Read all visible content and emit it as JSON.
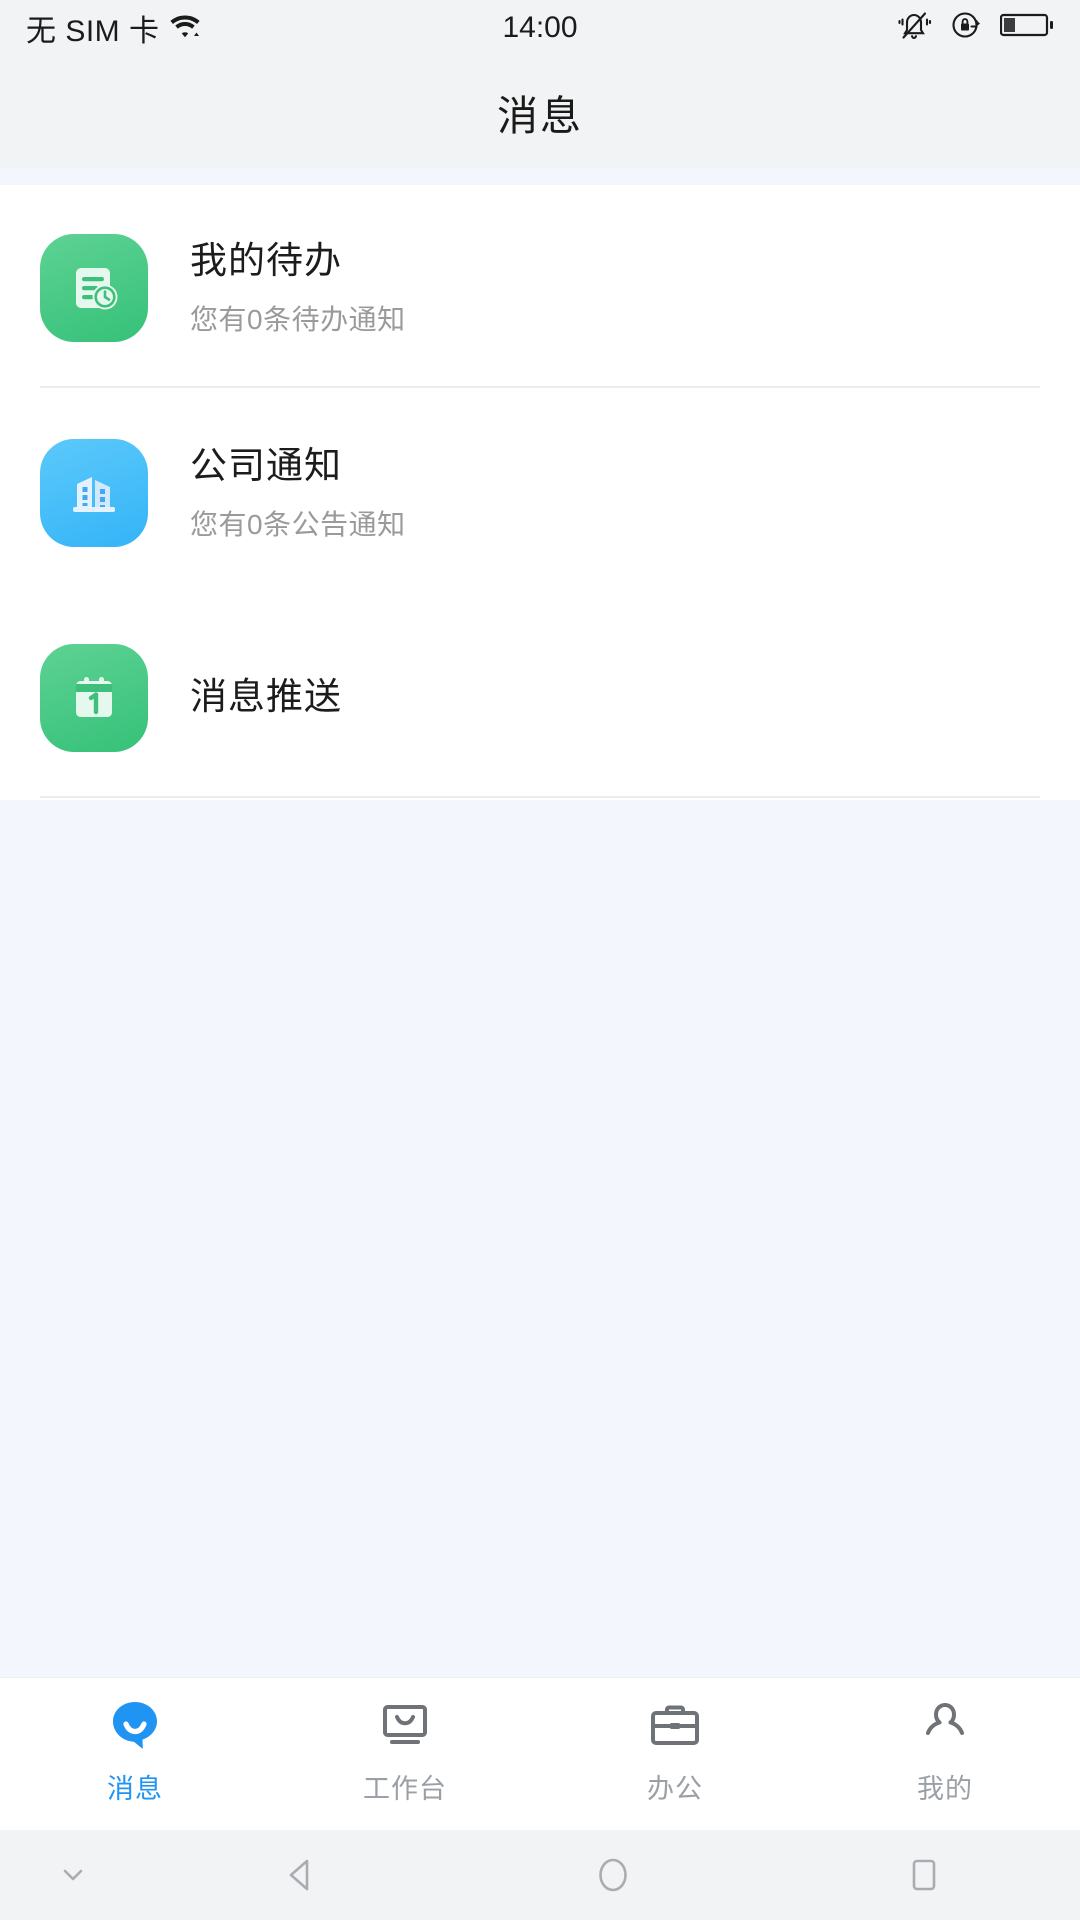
{
  "status_bar": {
    "carrier": "无 SIM 卡",
    "time": "14:00",
    "wifi_icon": "wifi-icon",
    "silent_icon": "bell-off-icon",
    "rotation_lock_icon": "rotation-lock-icon",
    "battery_icon": "battery-icon"
  },
  "header": {
    "title": "消息"
  },
  "list": {
    "items": [
      {
        "title": "我的待办",
        "subtitle": "您有0条待办通知",
        "icon": "todo-document-clock-icon",
        "icon_bg": "#4ecb8a"
      },
      {
        "title": "公司通知",
        "subtitle": "您有0条公告通知",
        "icon": "company-building-icon",
        "icon_bg": "#47bdf9"
      },
      {
        "title": "消息推送",
        "subtitle": "",
        "icon": "calendar-push-icon",
        "icon_bg": "#4ecb8a"
      }
    ]
  },
  "tab_bar": {
    "active_color": "#2094f3",
    "inactive_color": "#9b9fa6",
    "tabs": [
      {
        "label": "消息",
        "icon": "chat-bubble-icon",
        "active": true
      },
      {
        "label": "工作台",
        "icon": "monitor-icon",
        "active": false
      },
      {
        "label": "办公",
        "icon": "briefcase-icon",
        "active": false
      },
      {
        "label": "我的",
        "icon": "person-icon",
        "active": false
      }
    ]
  },
  "nav_bar": {
    "buttons": [
      {
        "icon": "chevron-down-icon"
      },
      {
        "icon": "back-triangle-icon"
      },
      {
        "icon": "home-circle-icon"
      },
      {
        "icon": "recents-square-icon"
      }
    ]
  }
}
